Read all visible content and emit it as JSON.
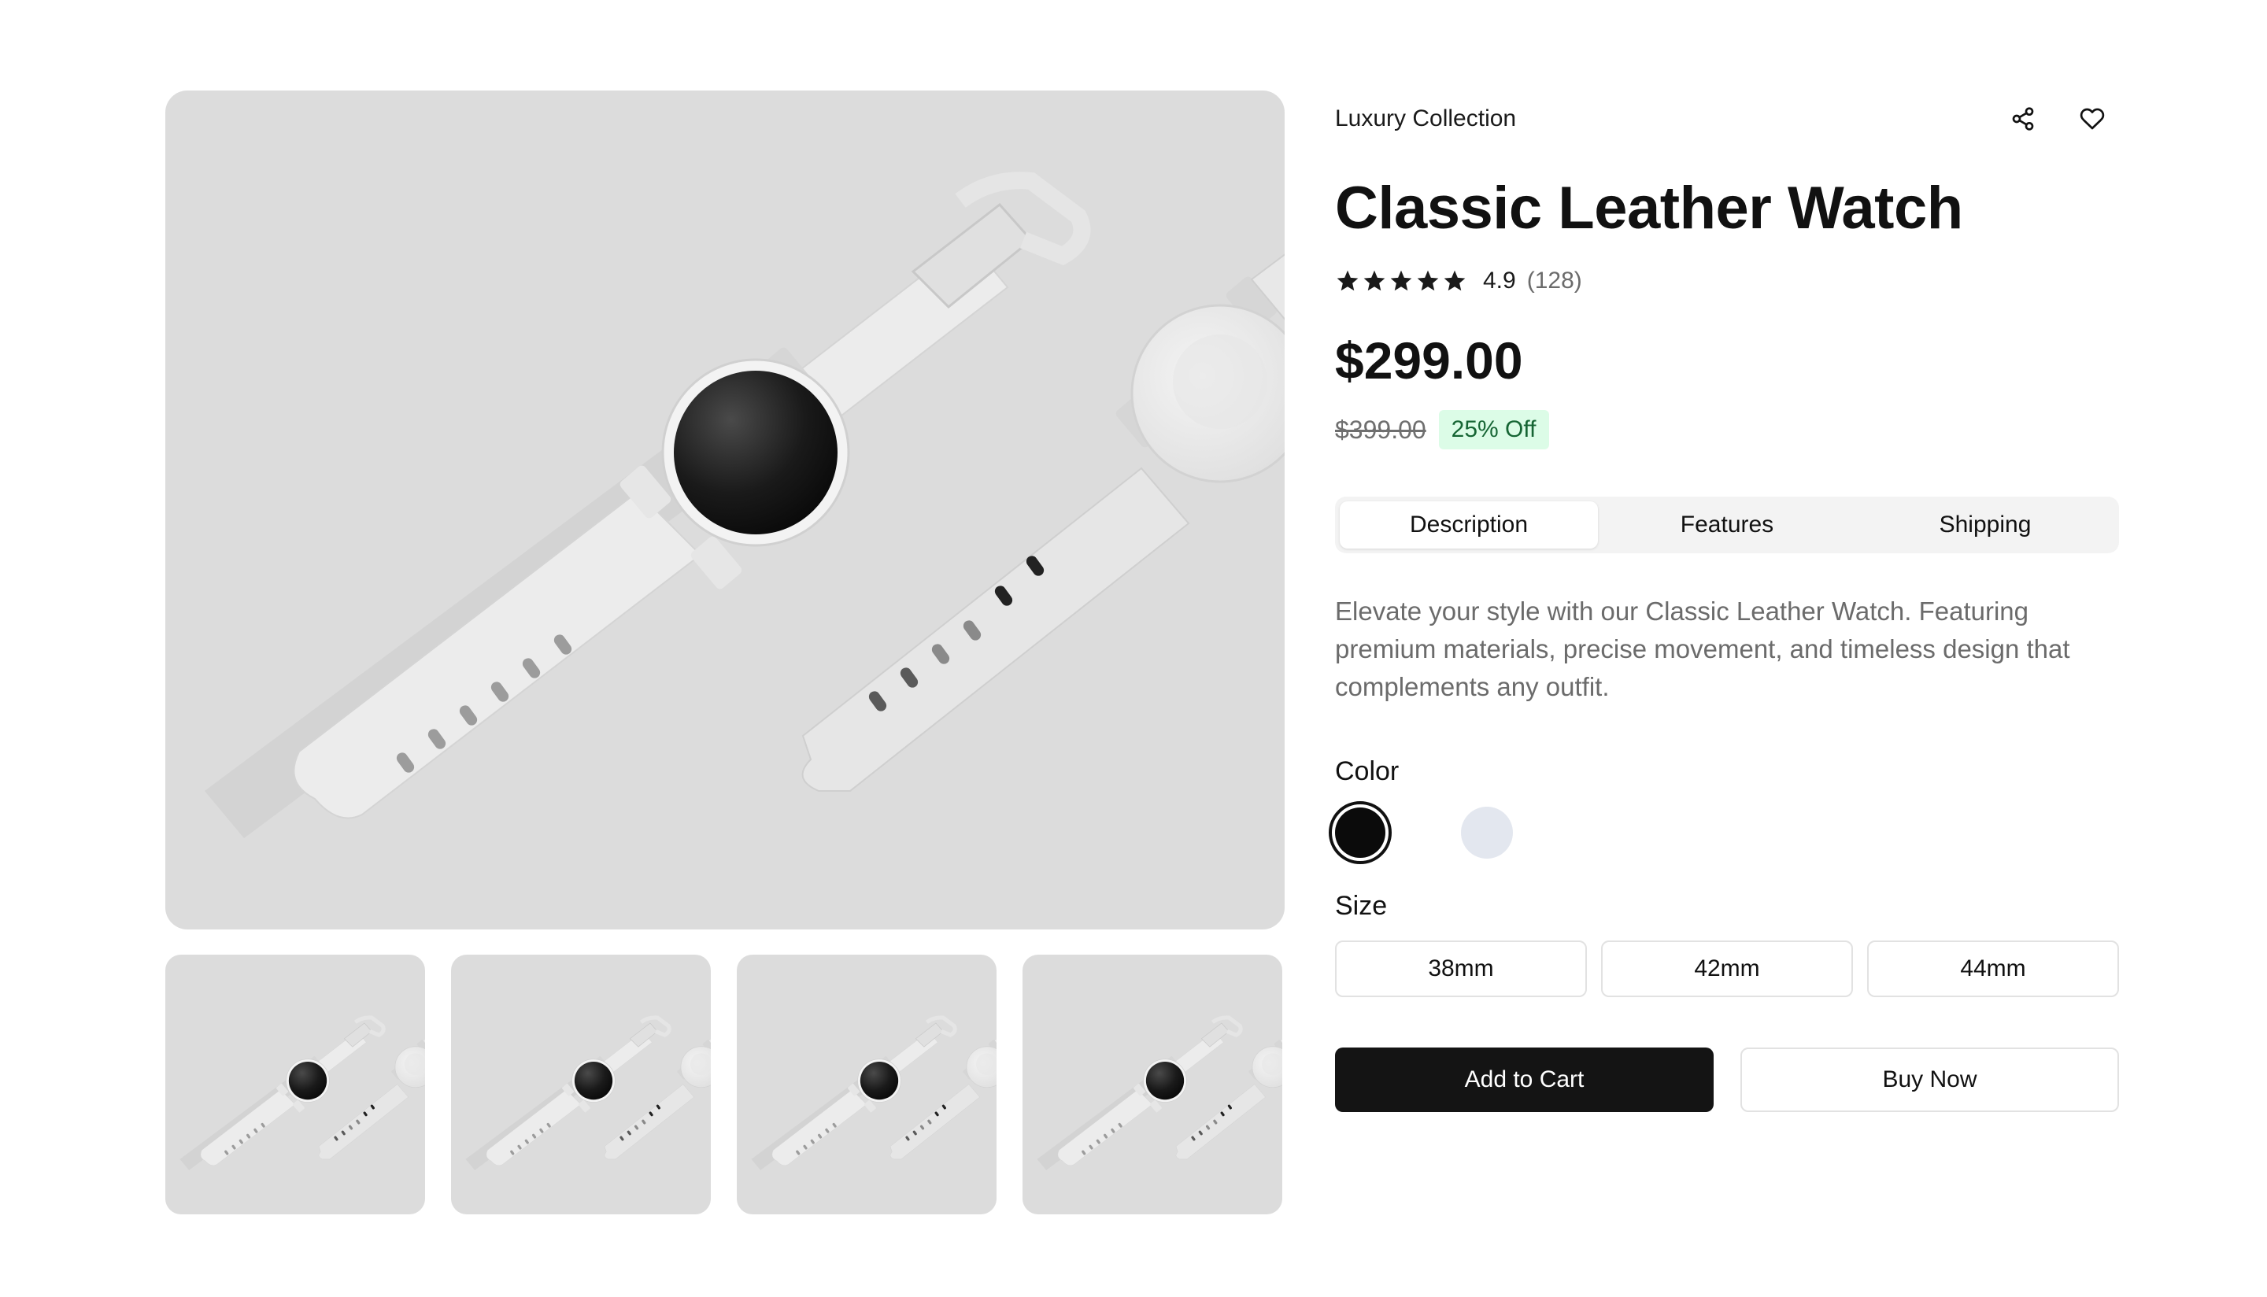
{
  "product": {
    "collection": "Luxury Collection",
    "title": "Classic Leather Watch",
    "rating": "4.9",
    "review_count": "(128)",
    "stars_filled": 5,
    "price": "$299.00",
    "original_price": "$399.00",
    "discount": "25% Off",
    "description": "Elevate your style with our Classic Leather Watch. Featuring premium materials, precise movement, and timeless design that complements any outfit."
  },
  "header_actions": {
    "share_icon": "share-icon",
    "wishlist_icon": "heart-icon"
  },
  "tabs": [
    {
      "label": "Description",
      "active": true
    },
    {
      "label": "Features",
      "active": false
    },
    {
      "label": "Shipping",
      "active": false
    }
  ],
  "color": {
    "label": "Color",
    "options": [
      {
        "value": "#0b0b0b",
        "selected": true
      },
      {
        "value": "#e3e7ef",
        "selected": false
      }
    ]
  },
  "size": {
    "label": "Size",
    "options": [
      "38mm",
      "42mm",
      "44mm"
    ]
  },
  "buttons": {
    "add_to_cart": "Add to Cart",
    "buy_now": "Buy Now"
  },
  "colors": {
    "image_bg": "#dcdcdc",
    "primary_button": "#141414",
    "discount_bg": "#dcfce7",
    "discount_text": "#166534"
  }
}
